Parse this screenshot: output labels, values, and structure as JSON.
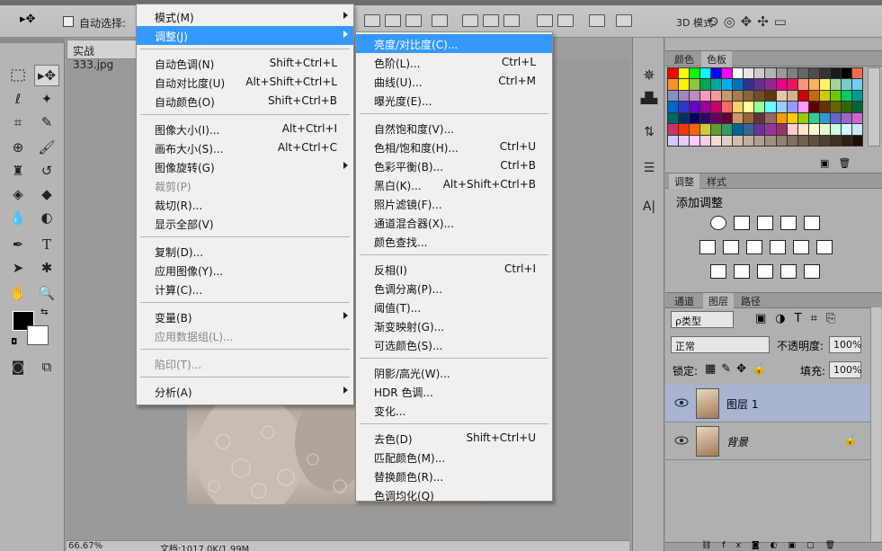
{
  "options_bar": {
    "auto_select_label": "自动选择:",
    "mode_3d_label": "3D 模式:"
  },
  "document": {
    "tab_title": "实战333.jpg",
    "zoom": "66.67%",
    "doc_info": "文档:1017.0K/1.99M"
  },
  "image_menu": {
    "items": [
      {
        "label": "模式(M)",
        "shortcut": "",
        "submenu": true,
        "disabled": false
      },
      {
        "label": "调整(J)",
        "shortcut": "",
        "submenu": true,
        "disabled": false,
        "highlighted": true
      },
      {
        "label": "自动色调(N)",
        "shortcut": "Shift+Ctrl+L",
        "submenu": false,
        "disabled": false
      },
      {
        "label": "自动对比度(U)",
        "shortcut": "Alt+Shift+Ctrl+L",
        "submenu": false,
        "disabled": false
      },
      {
        "label": "自动颜色(O)",
        "shortcut": "Shift+Ctrl+B",
        "submenu": false,
        "disabled": false
      },
      {
        "label": "图像大小(I)...",
        "shortcut": "Alt+Ctrl+I",
        "submenu": false,
        "disabled": false
      },
      {
        "label": "画布大小(S)...",
        "shortcut": "Alt+Ctrl+C",
        "submenu": false,
        "disabled": false
      },
      {
        "label": "图像旋转(G)",
        "shortcut": "",
        "submenu": true,
        "disabled": false
      },
      {
        "label": "裁剪(P)",
        "shortcut": "",
        "submenu": false,
        "disabled": true
      },
      {
        "label": "裁切(R)...",
        "shortcut": "",
        "submenu": false,
        "disabled": false
      },
      {
        "label": "显示全部(V)",
        "shortcut": "",
        "submenu": false,
        "disabled": false
      },
      {
        "label": "复制(D)...",
        "shortcut": "",
        "submenu": false,
        "disabled": false
      },
      {
        "label": "应用图像(Y)...",
        "shortcut": "",
        "submenu": false,
        "disabled": false
      },
      {
        "label": "计算(C)...",
        "shortcut": "",
        "submenu": false,
        "disabled": false
      },
      {
        "label": "变量(B)",
        "shortcut": "",
        "submenu": true,
        "disabled": false
      },
      {
        "label": "应用数据组(L)...",
        "shortcut": "",
        "submenu": false,
        "disabled": true
      },
      {
        "label": "陷印(T)...",
        "shortcut": "",
        "submenu": false,
        "disabled": true
      },
      {
        "label": "分析(A)",
        "shortcut": "",
        "submenu": true,
        "disabled": false
      }
    ]
  },
  "adjust_menu": {
    "items": [
      {
        "label": "亮度/对比度(C)...",
        "shortcut": "",
        "highlighted": true
      },
      {
        "label": "色阶(L)...",
        "shortcut": "Ctrl+L"
      },
      {
        "label": "曲线(U)...",
        "shortcut": "Ctrl+M"
      },
      {
        "label": "曝光度(E)...",
        "shortcut": ""
      },
      {
        "label": "自然饱和度(V)...",
        "shortcut": ""
      },
      {
        "label": "色相/饱和度(H)...",
        "shortcut": "Ctrl+U"
      },
      {
        "label": "色彩平衡(B)...",
        "shortcut": "Ctrl+B"
      },
      {
        "label": "黑白(K)...",
        "shortcut": "Alt+Shift+Ctrl+B"
      },
      {
        "label": "照片滤镜(F)...",
        "shortcut": ""
      },
      {
        "label": "通道混合器(X)...",
        "shortcut": ""
      },
      {
        "label": "颜色查找...",
        "shortcut": ""
      },
      {
        "label": "反相(I)",
        "shortcut": "Ctrl+I"
      },
      {
        "label": "色调分离(P)...",
        "shortcut": ""
      },
      {
        "label": "阈值(T)...",
        "shortcut": ""
      },
      {
        "label": "渐变映射(G)...",
        "shortcut": ""
      },
      {
        "label": "可选颜色(S)...",
        "shortcut": ""
      },
      {
        "label": "阴影/高光(W)...",
        "shortcut": ""
      },
      {
        "label": "HDR 色调...",
        "shortcut": ""
      },
      {
        "label": "变化...",
        "shortcut": ""
      },
      {
        "label": "去色(D)",
        "shortcut": "Shift+Ctrl+U"
      },
      {
        "label": "匹配颜色(M)...",
        "shortcut": ""
      },
      {
        "label": "替换颜色(R)...",
        "shortcut": ""
      },
      {
        "label": "色调均化(Q)",
        "shortcut": ""
      }
    ]
  },
  "color_panel": {
    "tabs": [
      "颜色",
      "色板"
    ],
    "active_tab": "色板",
    "swatch_colors": [
      "#ff0000",
      "#ffff00",
      "#00ff00",
      "#00ffff",
      "#0000ff",
      "#ff00ff",
      "#ffffff",
      "#e6e6e6",
      "#cccccc",
      "#b3b3b3",
      "#999999",
      "#808080",
      "#666666",
      "#4d4d4d",
      "#333333",
      "#1a1a1a",
      "#000000",
      "#f26c4f",
      "#f7941d",
      "#fff200",
      "#8dc63f",
      "#00a651",
      "#00a99d",
      "#00aeef",
      "#0072bc",
      "#2e3192",
      "#662d91",
      "#92278f",
      "#ec008c",
      "#ed145b",
      "#f69679",
      "#fbaf5d",
      "#fff568",
      "#a3d39c",
      "#7accc8",
      "#6dcff6",
      "#8393ca",
      "#a187be",
      "#bd8cbf",
      "#f49ac1",
      "#f5989d",
      "#c69c6d",
      "#a67c52",
      "#8c6239",
      "#754c24",
      "#603913",
      "#e5c8a8",
      "#d2b48c",
      "#cc0000",
      "#cc6600",
      "#cccc00",
      "#66cc00",
      "#00cc66",
      "#009999",
      "#0066cc",
      "#3333cc",
      "#6600cc",
      "#990099",
      "#cc0066",
      "#ff6666",
      "#ffcc66",
      "#ffff99",
      "#99ff99",
      "#66ffff",
      "#99ccff",
      "#9999ff",
      "#ff99ff",
      "#660000",
      "#663300",
      "#666600",
      "#336600",
      "#006633",
      "#006666",
      "#003366",
      "#000066",
      "#330066",
      "#660066",
      "#660033",
      "#cc9966",
      "#996633",
      "#663333",
      "#996666",
      "#ff9900",
      "#ffcc00",
      "#99cc00",
      "#33cc99",
      "#3399cc",
      "#6666cc",
      "#9966cc",
      "#cc66cc",
      "#cc3366",
      "#ff3300",
      "#ff6600",
      "#cccc33",
      "#669933",
      "#339966",
      "#006699",
      "#336699",
      "#663399",
      "#993399",
      "#993366",
      "#ffcccc",
      "#ffe5cc",
      "#ffffcc",
      "#e5ffcc",
      "#ccffe5",
      "#ccffff",
      "#cce5ff",
      "#ccccff",
      "#e5ccff",
      "#ffccff",
      "#ffcce5",
      "#f0e0d0",
      "#e0d0c0",
      "#d0c0b0",
      "#c0b0a0",
      "#b0a090",
      "#a09080",
      "#908070",
      "#807060",
      "#706050",
      "#605040",
      "#504030",
      "#403020",
      "#302010",
      "#201000",
      "#101000"
    ]
  },
  "adjust_panel": {
    "tabs": [
      "调整",
      "样式"
    ],
    "active_tab": "调整",
    "title": "添加调整"
  },
  "layers_panel": {
    "tabs": [
      "通道",
      "图层",
      "路径"
    ],
    "active_tab": "图层",
    "filter_kind": "ρ类型",
    "blend_mode": "正常",
    "opacity_label": "不透明度:",
    "opacity_value": "100%",
    "lock_label": "锁定:",
    "fill_label": "填充:",
    "fill_value": "100%",
    "layers": [
      {
        "name": "图层 1",
        "selected": true,
        "locked": false
      },
      {
        "name": "背景",
        "selected": false,
        "locked": true
      }
    ]
  }
}
